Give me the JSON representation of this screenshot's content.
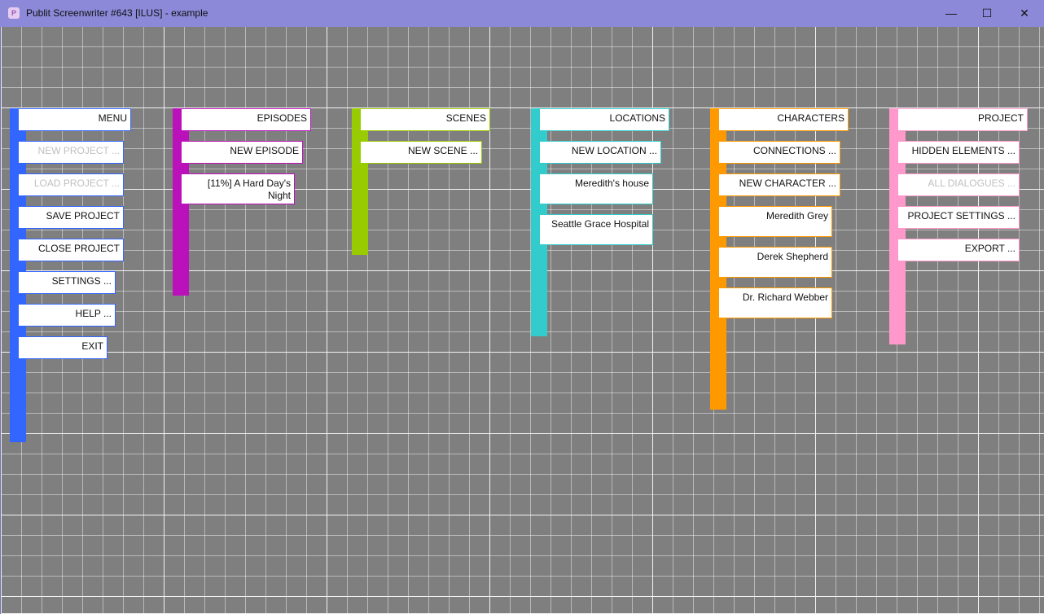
{
  "window": {
    "title": "Publit Screenwriter #643 [ILUS] - example",
    "app_icon_glyph": "P",
    "controls": {
      "minimize": "—",
      "maximize": "☐",
      "close": "✕"
    }
  },
  "colors": {
    "menu": "#3366ff",
    "episodes": "#bb11bb",
    "scenes": "#99cc00",
    "locations": "#33cccc",
    "characters": "#ff9900",
    "project": "#ff99cc"
  },
  "menu": {
    "header": "MENU",
    "items": [
      "NEW PROJECT ...",
      "LOAD PROJECT ...",
      "SAVE PROJECT",
      "CLOSE PROJECT",
      "SETTINGS ...",
      "HELP ...",
      "EXIT"
    ]
  },
  "episodes": {
    "header": "EPISODES",
    "items": [
      "NEW EPISODE",
      "[11%] A Hard Day's Night"
    ]
  },
  "scenes": {
    "header": "SCENES",
    "items": [
      "NEW SCENE ..."
    ]
  },
  "locations": {
    "header": "LOCATIONS",
    "items": [
      "NEW LOCATION ...",
      "Meredith's house",
      "Seattle Grace Hospital"
    ]
  },
  "characters": {
    "header": "CHARACTERS",
    "items": [
      "CONNECTIONS ...",
      "NEW CHARACTER ...",
      "Meredith Grey",
      "Derek Shepherd",
      "Dr. Richard Webber"
    ]
  },
  "project": {
    "header": "PROJECT",
    "items": [
      "HIDDEN ELEMENTS ...",
      "ALL DIALOGUES ...",
      "PROJECT SETTINGS ...",
      "EXPORT ..."
    ]
  }
}
